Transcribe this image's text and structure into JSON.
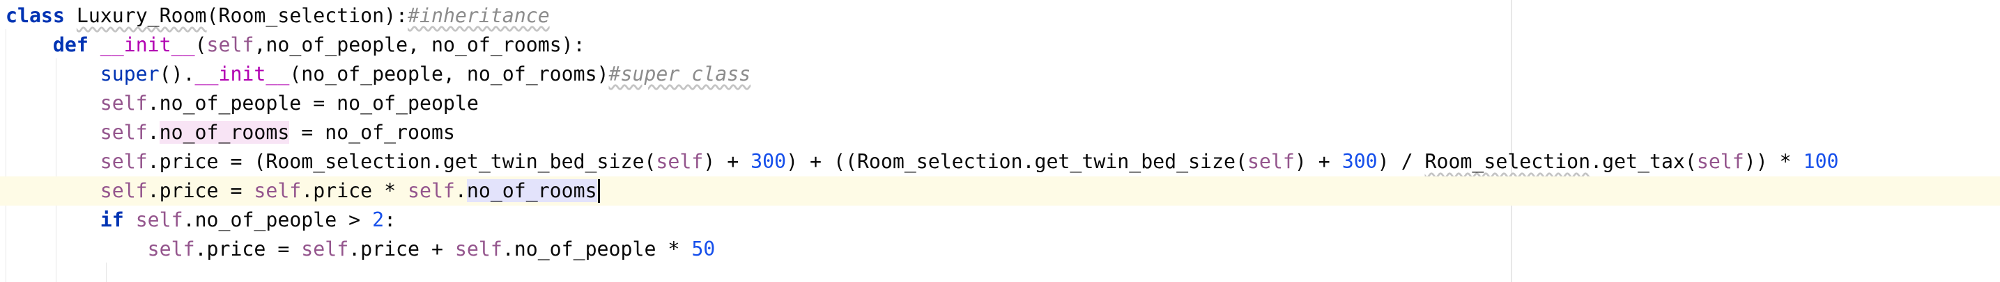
{
  "editor": {
    "language": "python",
    "lines": [
      [
        {
          "t": "class",
          "c": "kw"
        },
        {
          "t": " "
        },
        {
          "t": "Luxury_Room",
          "c": "typo"
        },
        {
          "t": "(Room_selection):"
        },
        {
          "t": "#inheritance",
          "c": "comment"
        }
      ],
      [
        {
          "t": "    "
        },
        {
          "t": "def",
          "c": "kw"
        },
        {
          "t": " "
        },
        {
          "t": "__init__",
          "c": "dunder"
        },
        {
          "t": "("
        },
        {
          "t": "self",
          "c": "self"
        },
        {
          "t": ",no_of_people, no_of_rooms):"
        }
      ],
      [
        {
          "t": "        "
        },
        {
          "t": "super",
          "c": "builtin"
        },
        {
          "t": "()."
        },
        {
          "t": "__init__",
          "c": "dunder"
        },
        {
          "t": "(no_of_people, no_of_rooms)"
        },
        {
          "t": "#super class",
          "c": "comment"
        }
      ],
      [
        {
          "t": "        "
        },
        {
          "t": "self",
          "c": "self"
        },
        {
          "t": ".no_of_people = no_of_people"
        }
      ],
      [
        {
          "t": "        "
        },
        {
          "t": "self",
          "c": "self"
        },
        {
          "t": "."
        },
        {
          "t": "no_of_rooms",
          "c": "hl-write"
        },
        {
          "t": " = no_of_rooms"
        }
      ],
      [
        {
          "t": "        "
        },
        {
          "t": "self",
          "c": "self"
        },
        {
          "t": ".price = (Room_selection.get_twin_bed_size("
        },
        {
          "t": "self",
          "c": "self"
        },
        {
          "t": ") + "
        },
        {
          "t": "300",
          "c": "num"
        },
        {
          "t": ") + ((Room_selection.get_twin_bed_size("
        },
        {
          "t": "self",
          "c": "self"
        },
        {
          "t": ") + "
        },
        {
          "t": "300",
          "c": "num"
        },
        {
          "t": ") / "
        },
        {
          "t": "Room_selection",
          "c": "typo"
        },
        {
          "t": ".get_tax("
        },
        {
          "t": "self",
          "c": "self"
        },
        {
          "t": ")) * "
        },
        {
          "t": "100",
          "c": "num"
        }
      ],
      [
        {
          "t": "        "
        },
        {
          "t": "self",
          "c": "self"
        },
        {
          "t": ".price = "
        },
        {
          "t": "self",
          "c": "self"
        },
        {
          "t": ".price * "
        },
        {
          "t": "self",
          "c": "self"
        },
        {
          "t": "."
        },
        {
          "t": "no_of_rooms",
          "c": "hl-read"
        }
      ],
      [
        {
          "t": "        "
        },
        {
          "t": "if",
          "c": "kw"
        },
        {
          "t": " "
        },
        {
          "t": "self",
          "c": "self"
        },
        {
          "t": ".no_of_people > "
        },
        {
          "t": "2",
          "c": "num"
        },
        {
          "t": ":"
        }
      ],
      [
        {
          "t": "            "
        },
        {
          "t": "self",
          "c": "self"
        },
        {
          "t": ".price = "
        },
        {
          "t": "self",
          "c": "self"
        },
        {
          "t": ".price + "
        },
        {
          "t": "self",
          "c": "self"
        },
        {
          "t": ".no_of_people * "
        },
        {
          "t": "50",
          "c": "num"
        }
      ]
    ]
  }
}
